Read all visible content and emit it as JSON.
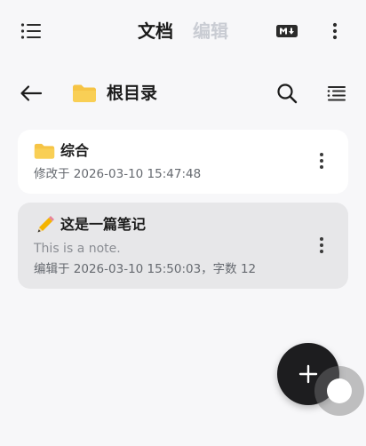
{
  "header": {
    "tabs": [
      {
        "label": "文档",
        "active": true
      },
      {
        "label": "编辑",
        "active": false
      }
    ],
    "icons": [
      "list-menu-icon",
      "markdown-icon",
      "more-vert-icon"
    ]
  },
  "path": {
    "current": "根目录",
    "icons": [
      "back-arrow-icon",
      "folder-icon",
      "search-icon",
      "list-view-icon"
    ]
  },
  "items": [
    {
      "type": "folder",
      "name": "综合",
      "meta": "修改于 2026-03-10 15:47:48",
      "icon": "folder-icon"
    },
    {
      "type": "note",
      "name": "这是一篇笔记",
      "preview": "This is a note.",
      "meta": "编辑于 2026-03-10 15:50:03，字数 12",
      "icon": "pencil-icon"
    }
  ],
  "fab": {
    "icon": "plus-icon"
  },
  "colors": {
    "background": "#f7f7f9",
    "folder": "#f6c445",
    "fab": "#1d1d1f",
    "selected_card": "#e7e7e9"
  }
}
